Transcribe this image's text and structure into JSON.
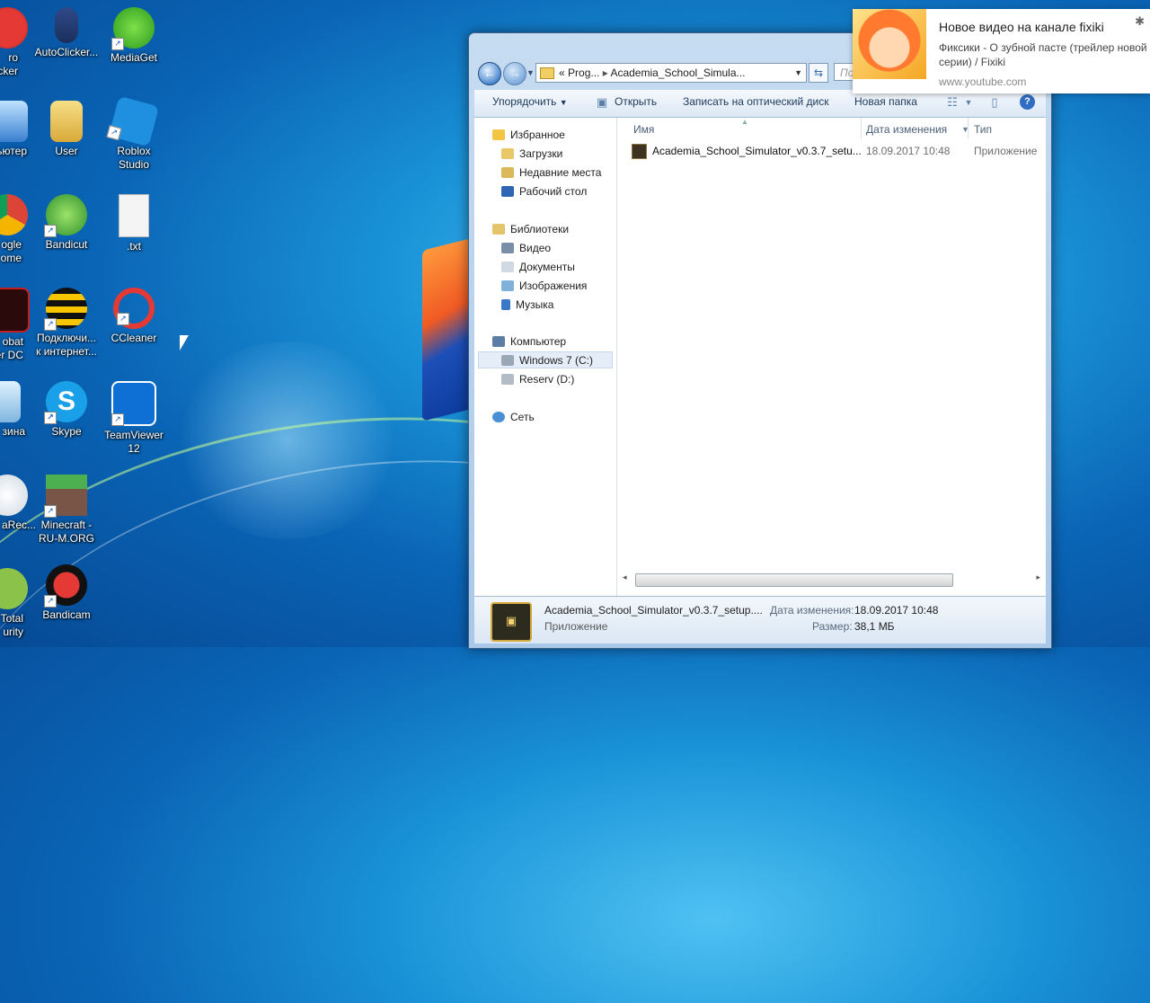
{
  "desktop_icons": [
    {
      "label": "ro\ncker"
    },
    {
      "label": "AutoClicker..."
    },
    {
      "label": "MediaGet"
    },
    {
      "label": "ьютер"
    },
    {
      "label": "User"
    },
    {
      "label": "Roblox\nStudio"
    },
    {
      "label": "ogle\nome"
    },
    {
      "label": "Bandicut"
    },
    {
      "label": ".txt"
    },
    {
      "label": "obat\ner DC"
    },
    {
      "label": "Подключи...\nк интернет..."
    },
    {
      "label": "CCleaner"
    },
    {
      "label": "зина"
    },
    {
      "label": "Skype"
    },
    {
      "label": "TeamViewer\n12"
    },
    {
      "label": "aRec..."
    },
    {
      "label": "Minecraft -\nRU-M.ORG"
    },
    {
      "label": "Total\nurity"
    },
    {
      "label": "Bandicam"
    }
  ],
  "explorer": {
    "address": {
      "part1": "Prog...",
      "part2": "Academia_School_Simula...",
      "prefix": "«"
    },
    "search_placeholder": "По",
    "toolbar": {
      "organize": "Упорядочить",
      "open": "Открыть",
      "burn": "Записать на оптический диск",
      "new_folder": "Новая папка"
    },
    "nav": {
      "favorites": "Избранное",
      "downloads": "Загрузки",
      "recent": "Недавние места",
      "desktop": "Рабочий стол",
      "libraries": "Библиотеки",
      "video": "Видео",
      "documents": "Документы",
      "images": "Изображения",
      "music": "Музыка",
      "computer": "Компьютер",
      "drive_c": "Windows 7 (C:)",
      "drive_d": "Reserv (D:)",
      "network": "Сеть"
    },
    "columns": {
      "name": "Имя",
      "date": "Дата изменения",
      "type": "Тип"
    },
    "files": [
      {
        "name": "Academia_School_Simulator_v0.3.7_setu...",
        "date": "18.09.2017 10:48",
        "type": "Приложение"
      }
    ],
    "details": {
      "filename": "Academia_School_Simulator_v0.3.7_setup....",
      "filetype": "Приложение",
      "date_label": "Дата изменения:",
      "date_value": "18.09.2017 10:48",
      "size_label": "Размер:",
      "size_value": "38,1 МБ"
    }
  },
  "notification": {
    "title": "Новое видео на канале fixiki",
    "body": "Фиксики - О зубной пасте (трейлер новой серии) / Fixiki",
    "source": "www.youtube.com"
  }
}
